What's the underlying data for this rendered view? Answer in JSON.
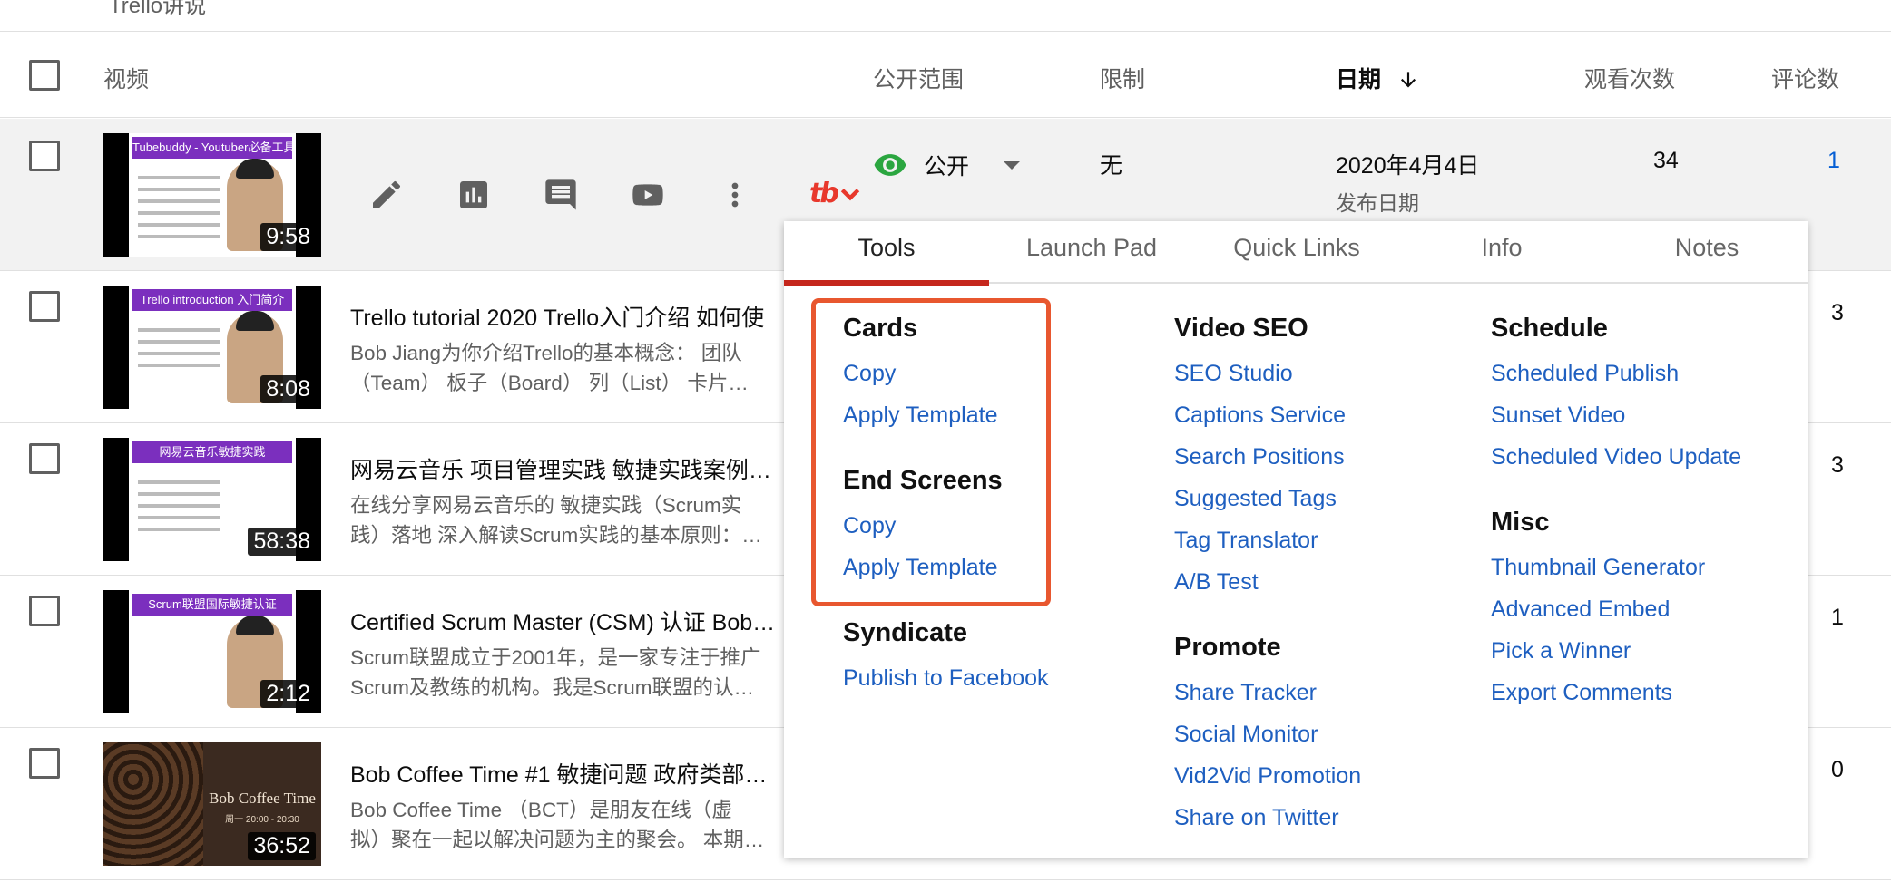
{
  "top_strip_text": "Trello讲说",
  "table_header": {
    "video": "视频",
    "visibility": "公开范围",
    "restrictions": "限制",
    "date": "日期",
    "views": "观看次数",
    "comments": "评论数"
  },
  "rows": [
    {
      "duration": "9:58",
      "thumb_title": "Tubebuddy - Youtuber必备工具",
      "visibility": "公开",
      "restriction": "无",
      "date": "2020年4月4日",
      "date_sub": "发布日期",
      "views": "34",
      "comments": "1"
    },
    {
      "duration": "8:08",
      "thumb_title": "Trello introduction 入门简介",
      "title": "Trello tutorial 2020 Trello入门介绍 如何使",
      "desc": "Bob Jiang为你介绍Trello的基本概念： 团队\n（Team） 板子（Board） 列（List） 卡片…",
      "comments": "3"
    },
    {
      "duration": "58:38",
      "thumb_title": "网易云音乐敏捷实践",
      "title": "网易云音乐 项目管理实践 敏捷实践案例…",
      "desc": "在线分享网易云音乐的 敏捷实践（Scrum实\n践）落地 深入解读Scrum实践的基本原则：…",
      "comments": "3"
    },
    {
      "duration": "2:12",
      "thumb_title": "Scrum联盟国际敏捷认证",
      "title": "Certified Scrum Master (CSM) 认证 Bob…",
      "desc": "Scrum联盟成立于2001年，是一家专注于推广\nScrum及教练的机构。我是Scrum联盟的认…",
      "comments": "1"
    },
    {
      "duration": "36:52",
      "thumb_title": "Bob Coffee Time",
      "thumb_sub": "周一 20:00 - 20:30",
      "title": "Bob Coffee Time #1 敏捷问题 政府类部…",
      "desc": "Bob Coffee Time （BCT）是朋友在线（虚\n拟）聚在一起以解决问题为主的聚会。 本期…",
      "comments": "0"
    }
  ],
  "tubebuddy": {
    "logo": "tb",
    "tabs": [
      "Tools",
      "Launch Pad",
      "Quick Links",
      "Info",
      "Notes"
    ],
    "active_tab": "Tools",
    "accent_color": "#c5271d",
    "link_color": "#1e5fc0",
    "highlight_color": "#e8572f",
    "col1": {
      "cards": {
        "heading": "Cards",
        "links": [
          "Copy",
          "Apply Template"
        ]
      },
      "end_screens": {
        "heading": "End Screens",
        "links": [
          "Copy",
          "Apply Template"
        ]
      },
      "syndicate": {
        "heading": "Syndicate",
        "links": [
          "Publish to Facebook"
        ]
      }
    },
    "col2": {
      "video_seo": {
        "heading": "Video SEO",
        "links": [
          "SEO Studio",
          "Captions Service",
          "Search Positions",
          "Suggested Tags",
          "Tag Translator",
          "A/B Test"
        ]
      },
      "promote": {
        "heading": "Promote",
        "links": [
          "Share Tracker",
          "Social Monitor",
          "Vid2Vid Promotion",
          "Share on Twitter"
        ]
      }
    },
    "col3": {
      "schedule": {
        "heading": "Schedule",
        "links": [
          "Scheduled Publish",
          "Sunset Video",
          "Scheduled Video Update"
        ]
      },
      "misc": {
        "heading": "Misc",
        "links": [
          "Thumbnail Generator",
          "Advanced Embed",
          "Pick a Winner",
          "Export Comments"
        ]
      }
    }
  }
}
